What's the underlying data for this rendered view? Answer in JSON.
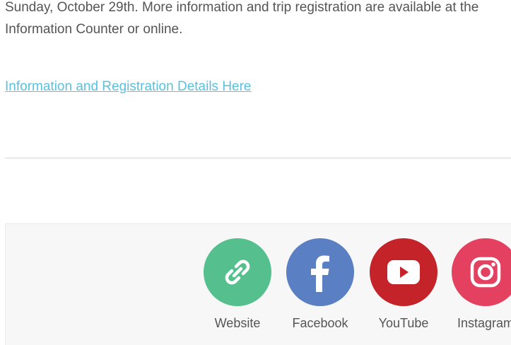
{
  "article": {
    "paragraph": "Sunday, October 29th.  More information and trip registration are available at the Information Counter or online.",
    "link_label": "Information and Registration Details Here"
  },
  "footer": {
    "social": [
      {
        "label": "Website",
        "icon": "link-icon",
        "color": "#56bf8e"
      },
      {
        "label": "Facebook",
        "icon": "facebook-icon",
        "color": "#5b7fc3"
      },
      {
        "label": "YouTube",
        "icon": "youtube-icon",
        "color": "#c4232a"
      },
      {
        "label": "Instagram",
        "icon": "instagram-icon",
        "color": "#e4405f"
      }
    ]
  }
}
